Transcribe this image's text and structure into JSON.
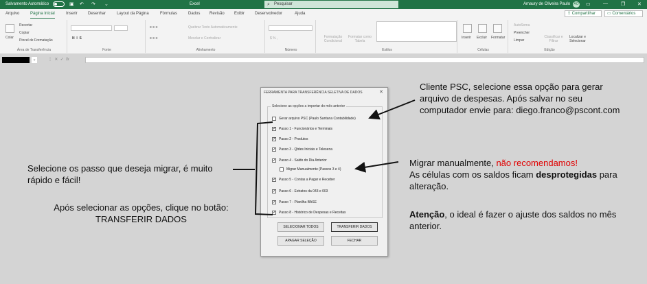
{
  "titlebar": {
    "autosave_label": "Salvamento Automático",
    "file_name": "Excel",
    "search_placeholder": "Pesquisar",
    "user_name": "Amaury de Oliveira Paulo",
    "user_initials": "AO"
  },
  "tabs": [
    "Arquivo",
    "Página Inicial",
    "Inserir",
    "Desenhar",
    "Layout da Página",
    "Fórmulas",
    "Dados",
    "Revisão",
    "Exibir",
    "Desenvolvedor",
    "Ajuda"
  ],
  "active_tab": "Página Inicial",
  "share_label": "Compartilhar",
  "comments_label": "Comentários",
  "ribbon": {
    "clipboard": {
      "paste": "Colar",
      "cut": "Recortar",
      "copy": "Copiar",
      "format_painter": "Pincel de Formatação",
      "label": "Área de Transferência"
    },
    "font": {
      "label": "Fonte"
    },
    "alignment": {
      "wrap": "Quebrar Texto Automaticamente",
      "merge": "Mesclar e Centralizar",
      "label": "Alinhamento"
    },
    "number": {
      "label": "Número"
    },
    "styles": {
      "cond": "Formatação Condicional",
      "table": "Formatar como Tabela",
      "label": "Estilos"
    },
    "cells": {
      "insert": "Inserir",
      "delete": "Excluir",
      "format": "Formatar",
      "label": "Células"
    },
    "editing": {
      "autosum": "AutoSoma",
      "fill": "Preencher",
      "clear": "Limpar",
      "sort": "Classificar e Filtrar",
      "find": "Localizar e Selecionar",
      "label": "Edição"
    }
  },
  "dialog": {
    "title": "FERRAMENTA PARA TRANSFERÊNCIA SELETIVA DE DADOS",
    "frame_label": "Selecione as opções a importar do mês anterior",
    "options": [
      {
        "label": "Gerar arquivo PSC (Paulo Santana Contabilidade)",
        "checked": false,
        "indent": 0
      },
      {
        "label": "Passo 1 - Funcionários e Terminais",
        "checked": true,
        "indent": 0
      },
      {
        "label": "Passo 2 - Produtos",
        "checked": true,
        "indent": 0
      },
      {
        "label": "Passo 3 - Qtdes Iniciais e Telesena",
        "checked": true,
        "indent": 0
      },
      {
        "label": "Passo 4 - Saldo do Dia Anterior",
        "checked": true,
        "indent": 0
      },
      {
        "label": "Migrar Manualmente (Passos 3 e 4)",
        "checked": false,
        "indent": 1
      },
      {
        "label": "Passo 5 - Contas a Pagar e Receber",
        "checked": true,
        "indent": 0
      },
      {
        "label": "Passo 6 - Extratos da 043 e 003",
        "checked": true,
        "indent": 0
      },
      {
        "label": "Passo 7 - Planilha BASE",
        "checked": true,
        "indent": 0
      },
      {
        "label": "Passo 8 - Histórico de Despesas e Receitas",
        "checked": true,
        "indent": 0
      }
    ],
    "buttons": {
      "select_all": "SELECIONAR TODOS",
      "transfer": "TRANSFERIR DADOS",
      "clear": "APAGAR SELEÇÃO",
      "close": "FECHAR"
    }
  },
  "annotations": {
    "psc": [
      "Cliente PSC, selecione essa opção para gerar",
      "arquivo de despesas. Após salvar no seu",
      "computador envie para: diego.franco@pscont.com"
    ],
    "select_steps": [
      "Selecione os passo que deseja migrar, é muito",
      "rápido e fácil!"
    ],
    "after_select": [
      "Após selecionar as opções, clique no botão:",
      "TRANSFERIR DADOS"
    ],
    "manual": {
      "line1_prefix": "Migrar manualmente, ",
      "line1_red": "não recomendamos!",
      "line2_prefix": "As células com os saldos ficam ",
      "line2_bold": "desprotegidas",
      "line2_suffix": " para",
      "line3": "alteração."
    },
    "attention": {
      "bold": "Atenção",
      "rest": ", o ideal é fazer o ajuste dos saldos no mês",
      "line2": "anterior."
    }
  }
}
